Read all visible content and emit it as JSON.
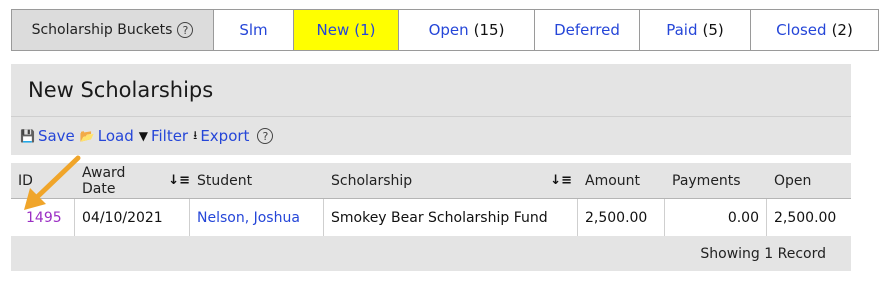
{
  "buckets": {
    "label": "Scholarship Buckets",
    "help": "?",
    "tabs": [
      {
        "label": "Slm",
        "count": ""
      },
      {
        "label": "New",
        "count": "(1)"
      },
      {
        "label": "Open",
        "count": "(15)"
      },
      {
        "label": "Deferred",
        "count": ""
      },
      {
        "label": "Paid",
        "count": "(5)"
      },
      {
        "label": "Closed",
        "count": "(2)"
      }
    ]
  },
  "panel": {
    "title": "New Scholarships"
  },
  "toolbar": {
    "save": "Save",
    "load": "Load",
    "filter": "Filter",
    "export": "Export",
    "help": "?"
  },
  "table": {
    "headers": [
      "ID",
      "Award Date",
      "Student",
      "Scholarship",
      "Amount",
      "Payments",
      "Open"
    ],
    "row": {
      "id": "1495",
      "award_date": "04/10/2021",
      "student": "Nelson, Joshua",
      "scholarship": "Smokey Bear Scholarship Fund",
      "amount": "2,500.00",
      "payments": "0.00",
      "open": "2,500.00"
    },
    "footer": "Showing 1 Record"
  },
  "colors": {
    "link": "#2546d8",
    "active_tab": "#ffff00",
    "id_link": "#9b2fc4",
    "arrow": "#f0a52a"
  }
}
